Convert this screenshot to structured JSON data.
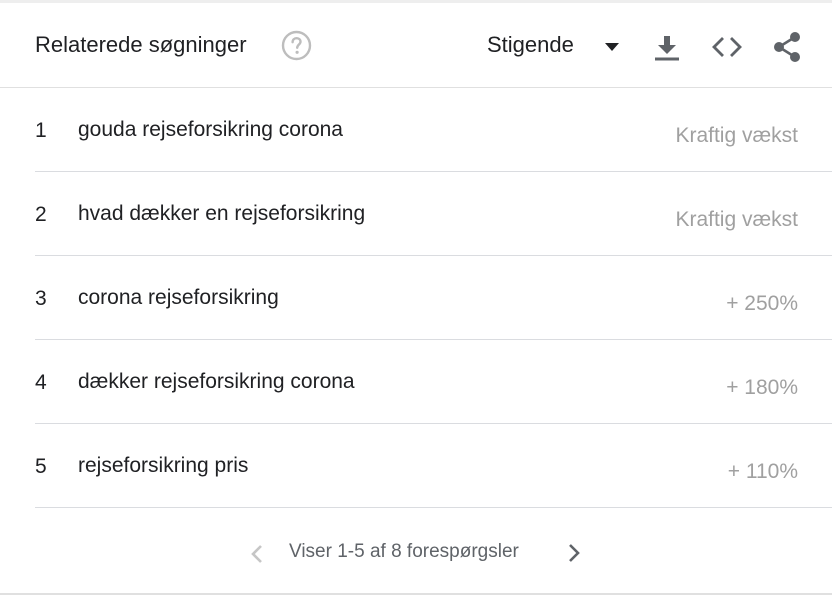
{
  "header": {
    "title": "Relaterede søgninger",
    "help_icon": "help-circle-icon",
    "sort_label": "Stigende",
    "sort_caret_icon": "caret-down-icon",
    "download_icon": "download-icon",
    "embed_icon": "code-embed-icon",
    "share_icon": "share-icon"
  },
  "rows": [
    {
      "rank": "1",
      "query": "gouda rejseforsikring corona",
      "value": "Kraftig vækst"
    },
    {
      "rank": "2",
      "query": "hvad dækker en rejseforsikring",
      "value": "Kraftig vækst"
    },
    {
      "rank": "3",
      "query": "corona rejseforsikring",
      "value": "+ 250%"
    },
    {
      "rank": "4",
      "query": "dækker rejseforsikring corona",
      "value": "+ 180%"
    },
    {
      "rank": "5",
      "query": "rejseforsikring pris",
      "value": "+ 110%"
    }
  ],
  "footer": {
    "pager_text": "Viser 1-5 af 8 forespørgsler",
    "prev_icon": "chevron-left-icon",
    "next_icon": "chevron-right-icon"
  },
  "colors": {
    "text": "#202124",
    "muted_value": "#a0a0a0",
    "icon": "#5f6368",
    "disabled_icon": "#c6c6c6",
    "divider": "#dadce0"
  }
}
